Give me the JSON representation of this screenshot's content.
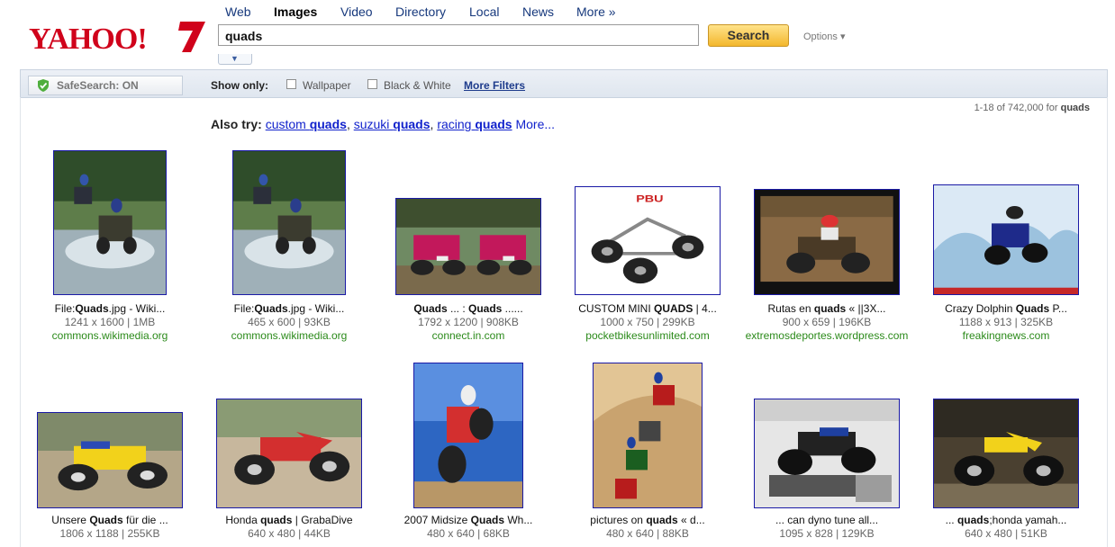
{
  "brand": {
    "logo_text": "YAHOO!",
    "logo_color": "#d0021b"
  },
  "nav": {
    "items": [
      {
        "label": "Web",
        "active": false
      },
      {
        "label": "Images",
        "active": true
      },
      {
        "label": "Video",
        "active": false
      },
      {
        "label": "Directory",
        "active": false
      },
      {
        "label": "Local",
        "active": false
      },
      {
        "label": "News",
        "active": false
      },
      {
        "label": "More »",
        "active": false
      }
    ]
  },
  "search": {
    "value": "quads",
    "button_label": "Search",
    "options_label": "Options ▾"
  },
  "filters": {
    "safesearch_label": "SafeSearch: ON",
    "show_only_label": "Show only:",
    "wallpaper_label": "Wallpaper",
    "bw_label": "Black & White",
    "more_filters_label": "More Filters"
  },
  "result_count": {
    "prefix": "1-18 of 742,000 for",
    "query": "quads"
  },
  "also_try": {
    "label": "Also try:",
    "suggestions": [
      {
        "pre": "custom ",
        "bold": "quads"
      },
      {
        "pre": "suzuki ",
        "bold": "quads"
      },
      {
        "pre": "racing ",
        "bold": "quads"
      }
    ],
    "more_label": "More..."
  },
  "results": [
    {
      "title_pre": "File:",
      "title_bold": "Quads",
      "title_post": ".jpg - Wiki...",
      "meta": "1241 x 1600 | 1MB",
      "domain": "commons.wikimedia.org",
      "thumb_desc": "atv-splash-green"
    },
    {
      "title_pre": "File:",
      "title_bold": "Quads",
      "title_post": ".jpg - Wiki...",
      "meta": "465 x 600 | 93KB",
      "domain": "commons.wikimedia.org",
      "thumb_desc": "atv-splash-green"
    },
    {
      "title_pre": "",
      "title_bold": "Quads",
      "title_post": " ... : Quads ......",
      "title_bold2": true,
      "meta": "1792 x 1200 | 908KB",
      "domain": "connect.in.com",
      "thumb_desc": "pink-quads"
    },
    {
      "title_pre": "CUSTOM MINI ",
      "title_bold": "QUADS",
      "title_post": " | 4...",
      "meta": "1000 x 750 | 299KB",
      "domain": "pocketbikesunlimited.com",
      "thumb_desc": "mini-quad-white"
    },
    {
      "title_pre": "Rutas en ",
      "title_bold": "quads",
      "title_post": " « ||3X...",
      "meta": "900 x 659 | 196KB",
      "domain": "extremosdeportes.wordpress.com",
      "thumb_desc": "dirt-quad"
    },
    {
      "title_pre": "Crazy Dolphin ",
      "title_bold": "Quads",
      "title_post": " P...",
      "meta": "1188 x 913 | 325KB",
      "domain": "freakingnews.com",
      "thumb_desc": "water-splash"
    },
    {
      "title_pre": "Unsere ",
      "title_bold": "Quads",
      "title_post": " für die ...",
      "meta": "1806 x 1188 | 255KB",
      "domain": "",
      "thumb_desc": "yellow-quad"
    },
    {
      "title_pre": "Honda ",
      "title_bold": "quads",
      "title_post": " | GrabaDive",
      "meta": "640 x 480 | 44KB",
      "domain": "",
      "thumb_desc": "red-honda"
    },
    {
      "title_pre": "2007 Midsize ",
      "title_bold": "Quads",
      "title_post": " Wh...",
      "meta": "480 x 640 | 68KB",
      "domain": "",
      "thumb_desc": "wheelie-sky"
    },
    {
      "title_pre": "pictures on ",
      "title_bold": "quads",
      "title_post": " « d...",
      "meta": "480 x 640 | 88KB",
      "domain": "",
      "thumb_desc": "dune-riders"
    },
    {
      "title_pre": "... can dyno tune all...",
      "title_bold": "",
      "title_post": "",
      "meta": "1095 x 828 | 129KB",
      "domain": "",
      "thumb_desc": "dyno-quad"
    },
    {
      "title_pre": "... ",
      "title_bold": "quads",
      "title_post": ";honda yamah...",
      "meta": "640 x 480 | 51KB",
      "domain": "",
      "thumb_desc": "yellow-pitbike"
    }
  ],
  "colors": {
    "link": "#1122cc",
    "domain": "#2b8a1a",
    "nav": "#16387c",
    "search_button": "#f3b72d"
  }
}
